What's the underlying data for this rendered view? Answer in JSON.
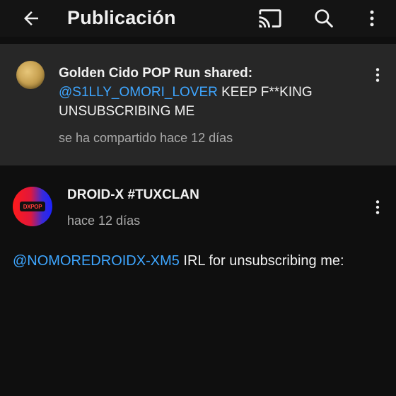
{
  "topbar": {
    "title": "Publicación",
    "icons": [
      "back-arrow-icon",
      "cast-icon",
      "search-icon",
      "more-vert-icon"
    ]
  },
  "shared": {
    "author": "Golden Cido POP Run shared:",
    "mention": "@S1LLY_OMORI_LOVER",
    "text": " KEEP F**KING UNSUBSCRIBING ME",
    "time": "se ha compartido hace 12 días"
  },
  "post": {
    "author": "DROID-X #TUXCLAN",
    "time": "hace 12 días",
    "avatar_text": "DXPOP",
    "mention": "@NOMOREDROIDX-XM5",
    "text": " IRL for unsubscribing me:"
  },
  "colors": {
    "background": "#0f0f0f",
    "card": "#272727",
    "mention": "#3ea6ff",
    "secondary_text": "#aaaaaa"
  }
}
